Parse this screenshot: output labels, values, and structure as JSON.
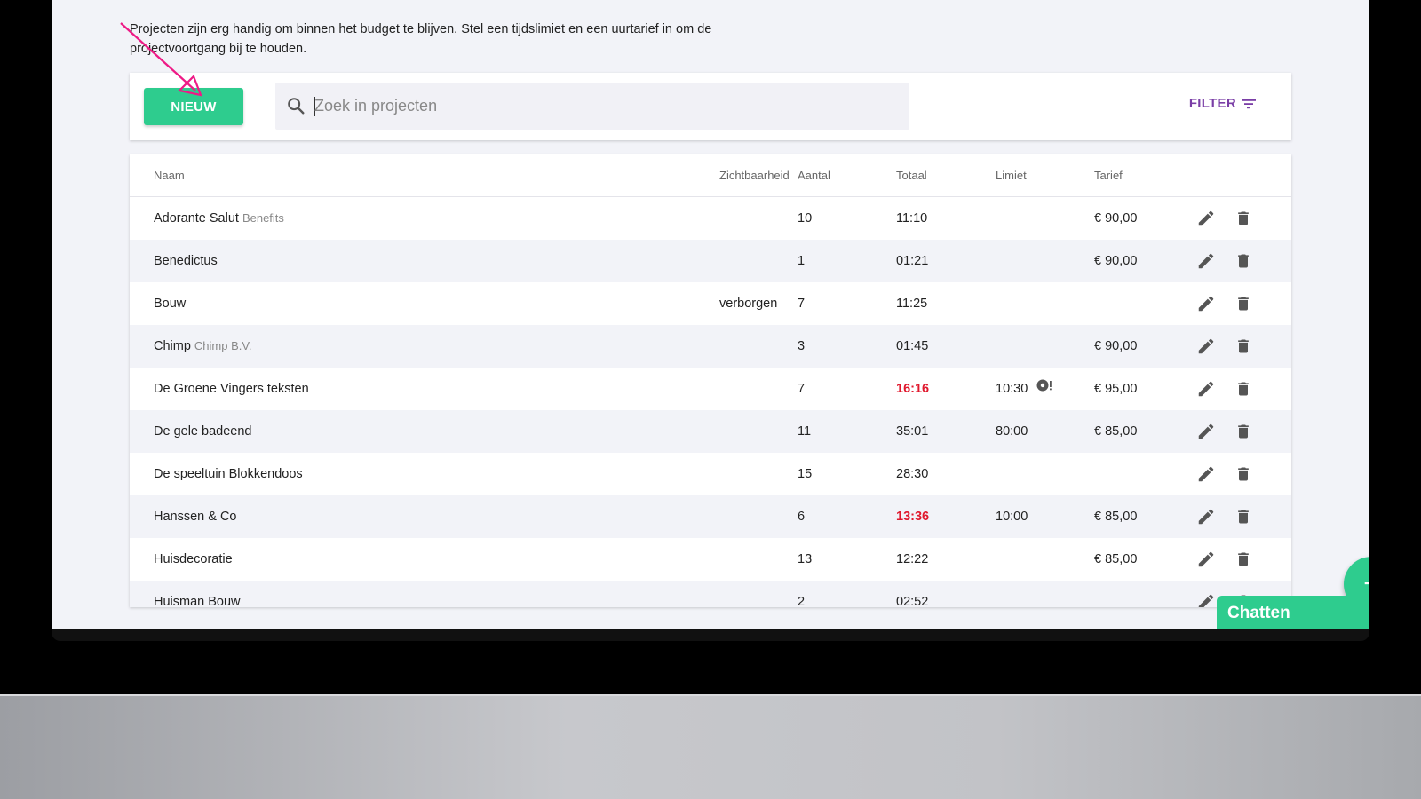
{
  "intro_text": "Projecten zijn erg handig om binnen het budget te blijven. Stel een tijdslimiet en een uurtarief in om de projectvoortgang bij te houden.",
  "toolbar": {
    "new_label": "NIEUW",
    "search_placeholder": "Zoek in projecten",
    "filter_label": "FILTER"
  },
  "table": {
    "headers": {
      "name": "Naam",
      "visibility": "Zichtbaarheid",
      "count": "Aantal",
      "total": "Totaal",
      "limit": "Limiet",
      "rate": "Tarief"
    },
    "rows": [
      {
        "name": "Adorante Salut",
        "client": "Benefits",
        "visibility": "",
        "count": "10",
        "total": "11:10",
        "over": false,
        "limit": "",
        "rate": "€ 90,00"
      },
      {
        "name": "Benedictus",
        "client": "",
        "visibility": "",
        "count": "1",
        "total": "01:21",
        "over": false,
        "limit": "",
        "rate": "€ 90,00"
      },
      {
        "name": "Bouw",
        "client": "",
        "visibility": "verborgen",
        "count": "7",
        "total": "11:25",
        "over": false,
        "limit": "",
        "rate": ""
      },
      {
        "name": "Chimp",
        "client": "Chimp B.V.",
        "visibility": "",
        "count": "3",
        "total": "01:45",
        "over": false,
        "limit": "",
        "rate": "€ 90,00"
      },
      {
        "name": "De Groene Vingers teksten",
        "client": "",
        "visibility": "",
        "count": "7",
        "total": "16:16",
        "over": true,
        "limit": "10:30",
        "warn": true,
        "rate": "€ 95,00"
      },
      {
        "name": "De gele badeend",
        "client": "",
        "visibility": "",
        "count": "11",
        "total": "35:01",
        "over": false,
        "limit": "80:00",
        "rate": "€ 85,00"
      },
      {
        "name": "De speeltuin Blokkendoos",
        "client": "",
        "visibility": "",
        "count": "15",
        "total": "28:30",
        "over": false,
        "limit": "",
        "rate": ""
      },
      {
        "name": "Hanssen & Co",
        "client": "",
        "visibility": "",
        "count": "6",
        "total": "13:36",
        "over": true,
        "limit": "10:00",
        "rate": "€ 85,00"
      },
      {
        "name": "Huisdecoratie",
        "client": "",
        "visibility": "",
        "count": "13",
        "total": "12:22",
        "over": false,
        "limit": "",
        "rate": "€ 85,00"
      },
      {
        "name": "Huisman Bouw",
        "client": "",
        "visibility": "",
        "count": "2",
        "total": "02:52",
        "over": false,
        "limit": "",
        "rate": ""
      }
    ]
  },
  "chat": {
    "label": "Chatten"
  },
  "fab": {
    "label": "+"
  },
  "colors": {
    "accent": "#2ecc8e",
    "filter": "#7a3ea6",
    "over": "#e0182d",
    "arrow": "#ee1a86"
  },
  "icons": {
    "search": "search-icon",
    "filter": "filter-icon",
    "edit": "pencil-icon",
    "delete": "trash-icon",
    "warning": "alarm-icon",
    "chat_toggle": "chevron-up-icon"
  }
}
